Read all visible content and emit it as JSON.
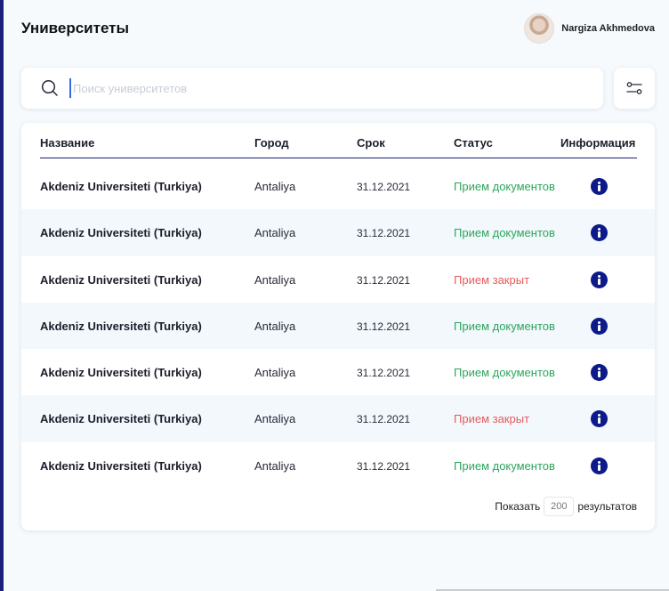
{
  "page": {
    "title": "Университеты"
  },
  "user": {
    "name": "Nargiza Akhmedova"
  },
  "search": {
    "placeholder": "Поиск университетов",
    "value": ""
  },
  "table": {
    "headers": [
      "Название",
      "Город",
      "Срок",
      "Статус",
      "Информация"
    ],
    "rows": [
      {
        "name": "Akdeniz Universiteti (Turkiya)",
        "city": "Antaliya",
        "date": "31.12.2021",
        "status": "Прием документов",
        "state": "open"
      },
      {
        "name": "Akdeniz Universiteti (Turkiya)",
        "city": "Antaliya",
        "date": "31.12.2021",
        "status": "Прием документов",
        "state": "open"
      },
      {
        "name": "Akdeniz Universiteti (Turkiya)",
        "city": "Antaliya",
        "date": "31.12.2021",
        "status": "Прием закрыт",
        "state": "closed"
      },
      {
        "name": "Akdeniz Universiteti (Turkiya)",
        "city": "Antaliya",
        "date": "31.12.2021",
        "status": "Прием документов",
        "state": "open"
      },
      {
        "name": "Akdeniz Universiteti (Turkiya)",
        "city": "Antaliya",
        "date": "31.12.2021",
        "status": "Прием документов",
        "state": "open"
      },
      {
        "name": "Akdeniz Universiteti (Turkiya)",
        "city": "Antaliya",
        "date": "31.12.2021",
        "status": "Прием закрыт",
        "state": "closed"
      },
      {
        "name": "Akdeniz Universiteti (Turkiya)",
        "city": "Antaliya",
        "date": "31.12.2021",
        "status": "Прием документов",
        "state": "open"
      }
    ]
  },
  "pagination": {
    "show_label": "Показать",
    "page_size": "200",
    "results_label": "результатов"
  },
  "icons": {
    "search": "search-icon",
    "filter": "filter-sliders-icon",
    "info": "info-icon"
  },
  "colors": {
    "accent": "#1c1f7a",
    "open": "#2ea55c",
    "closed": "#e75b5b",
    "info": "#0c1a8a"
  }
}
